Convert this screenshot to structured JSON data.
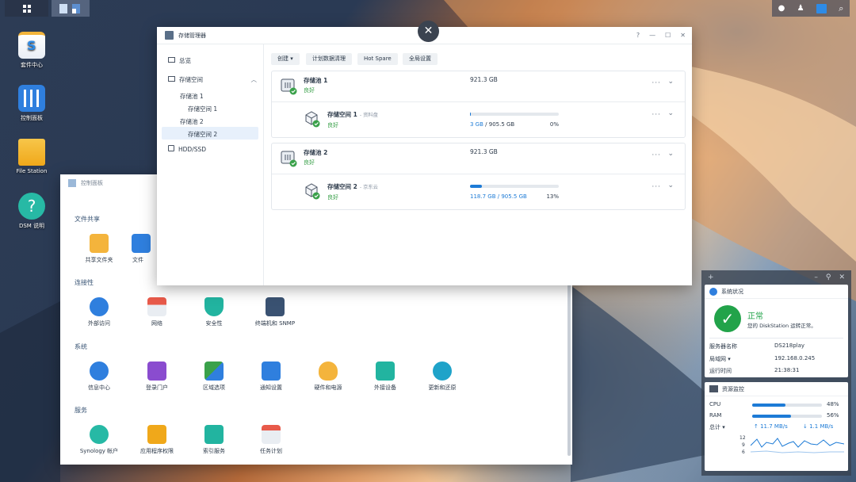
{
  "desktop": {
    "icons": [
      {
        "label": "套件中心"
      },
      {
        "label": "控制面板"
      },
      {
        "label": "File Station"
      },
      {
        "label": "DSM 说明"
      }
    ]
  },
  "control_panel": {
    "title": "控制面板",
    "sections": [
      {
        "title": "文件共享",
        "items": [
          "共享文件夹",
          "文件"
        ]
      },
      {
        "title": "连接性",
        "items": [
          "外部访问",
          "网络",
          "安全性",
          "终端机和 SNMP"
        ]
      },
      {
        "title": "系统",
        "items": [
          "信息中心",
          "登录门户",
          "区域选项",
          "通知设置",
          "硬件和电源",
          "外接设备",
          "更新和还原"
        ]
      },
      {
        "title": "服务",
        "items": [
          "Synology 帐户",
          "应用程序权限",
          "索引服务",
          "任务计划"
        ]
      }
    ]
  },
  "storage_manager": {
    "title": "存储管理器",
    "controls": {
      "help": "?",
      "minimize": "—",
      "maximize": "☐",
      "close": "✕"
    },
    "sidebar": {
      "overview": "总览",
      "storage": "存储空间",
      "pool1": "存储池 1",
      "vol1": "存储空间 1",
      "pool2": "存储池 2",
      "vol2": "存储空间 2",
      "hdd": "HDD/SSD"
    },
    "toolbar": {
      "create": "创建",
      "schedule": "计划数据清理",
      "hotspare": "Hot Spare",
      "global": "全局设置"
    },
    "pools": [
      {
        "name": "存储池 1",
        "status": "良好",
        "capacity": "921.3 GB",
        "volume": {
          "name": "存储空间 1",
          "desc": "- 资料盘",
          "status": "良好",
          "used": "3 GB",
          "total": "905.5 GB",
          "usage_sep": "/",
          "percent": "0%",
          "fraction": 0.01
        }
      },
      {
        "name": "存储池 2",
        "status": "良好",
        "capacity": "921.3 GB",
        "volume": {
          "name": "存储空间 2",
          "desc": "- 京东云",
          "status": "良好",
          "used": "118.7 GB",
          "total": "905.5 GB",
          "usage_sep": "/",
          "percent": "13%",
          "fraction": 0.13
        }
      }
    ]
  },
  "widgets": {
    "system": {
      "title": "系统状况",
      "status": "正常",
      "message": "您的 DiskStation 运转正常。",
      "rows": [
        {
          "k": "服务器名称",
          "v": "DS218play"
        },
        {
          "k": "局域网 ▾",
          "v": "192.168.0.245"
        },
        {
          "k": "运行时间",
          "v": "21:38:31"
        }
      ]
    },
    "resource": {
      "title": "资源监控",
      "cpu_label": "CPU",
      "cpu_pct": "48%",
      "cpu": 0.48,
      "ram_label": "RAM",
      "ram_pct": "56%",
      "ram": 0.56,
      "total_label": "总计 ▾",
      "up": "11.7 MB/s",
      "down": "1.1 MB/s",
      "y_ticks": [
        "12",
        "9",
        "6"
      ]
    }
  },
  "colors": {
    "accent": "#1d7bd6",
    "ok": "#3aa14a"
  }
}
